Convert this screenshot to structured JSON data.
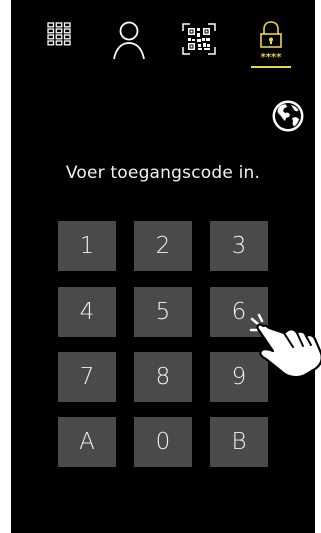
{
  "topbar": {
    "icons": [
      {
        "name": "keypad-grid-icon",
        "active": false
      },
      {
        "name": "user-icon",
        "active": false
      },
      {
        "name": "qr-code-icon",
        "active": false
      },
      {
        "name": "lock-code-icon",
        "active": true
      }
    ],
    "lock_code_mask": "****",
    "accent_color": "#e6d64a"
  },
  "language_button": {
    "icon": "globe-icon"
  },
  "prompt": {
    "text": "Voer toegangscode in."
  },
  "keypad": {
    "keys": [
      "1",
      "2",
      "3",
      "4",
      "5",
      "6",
      "7",
      "8",
      "9",
      "A",
      "0",
      "B"
    ],
    "key_color": "#4a4a4a",
    "pressed_key": "6"
  },
  "cursor": {
    "icon": "pointing-hand-icon"
  }
}
